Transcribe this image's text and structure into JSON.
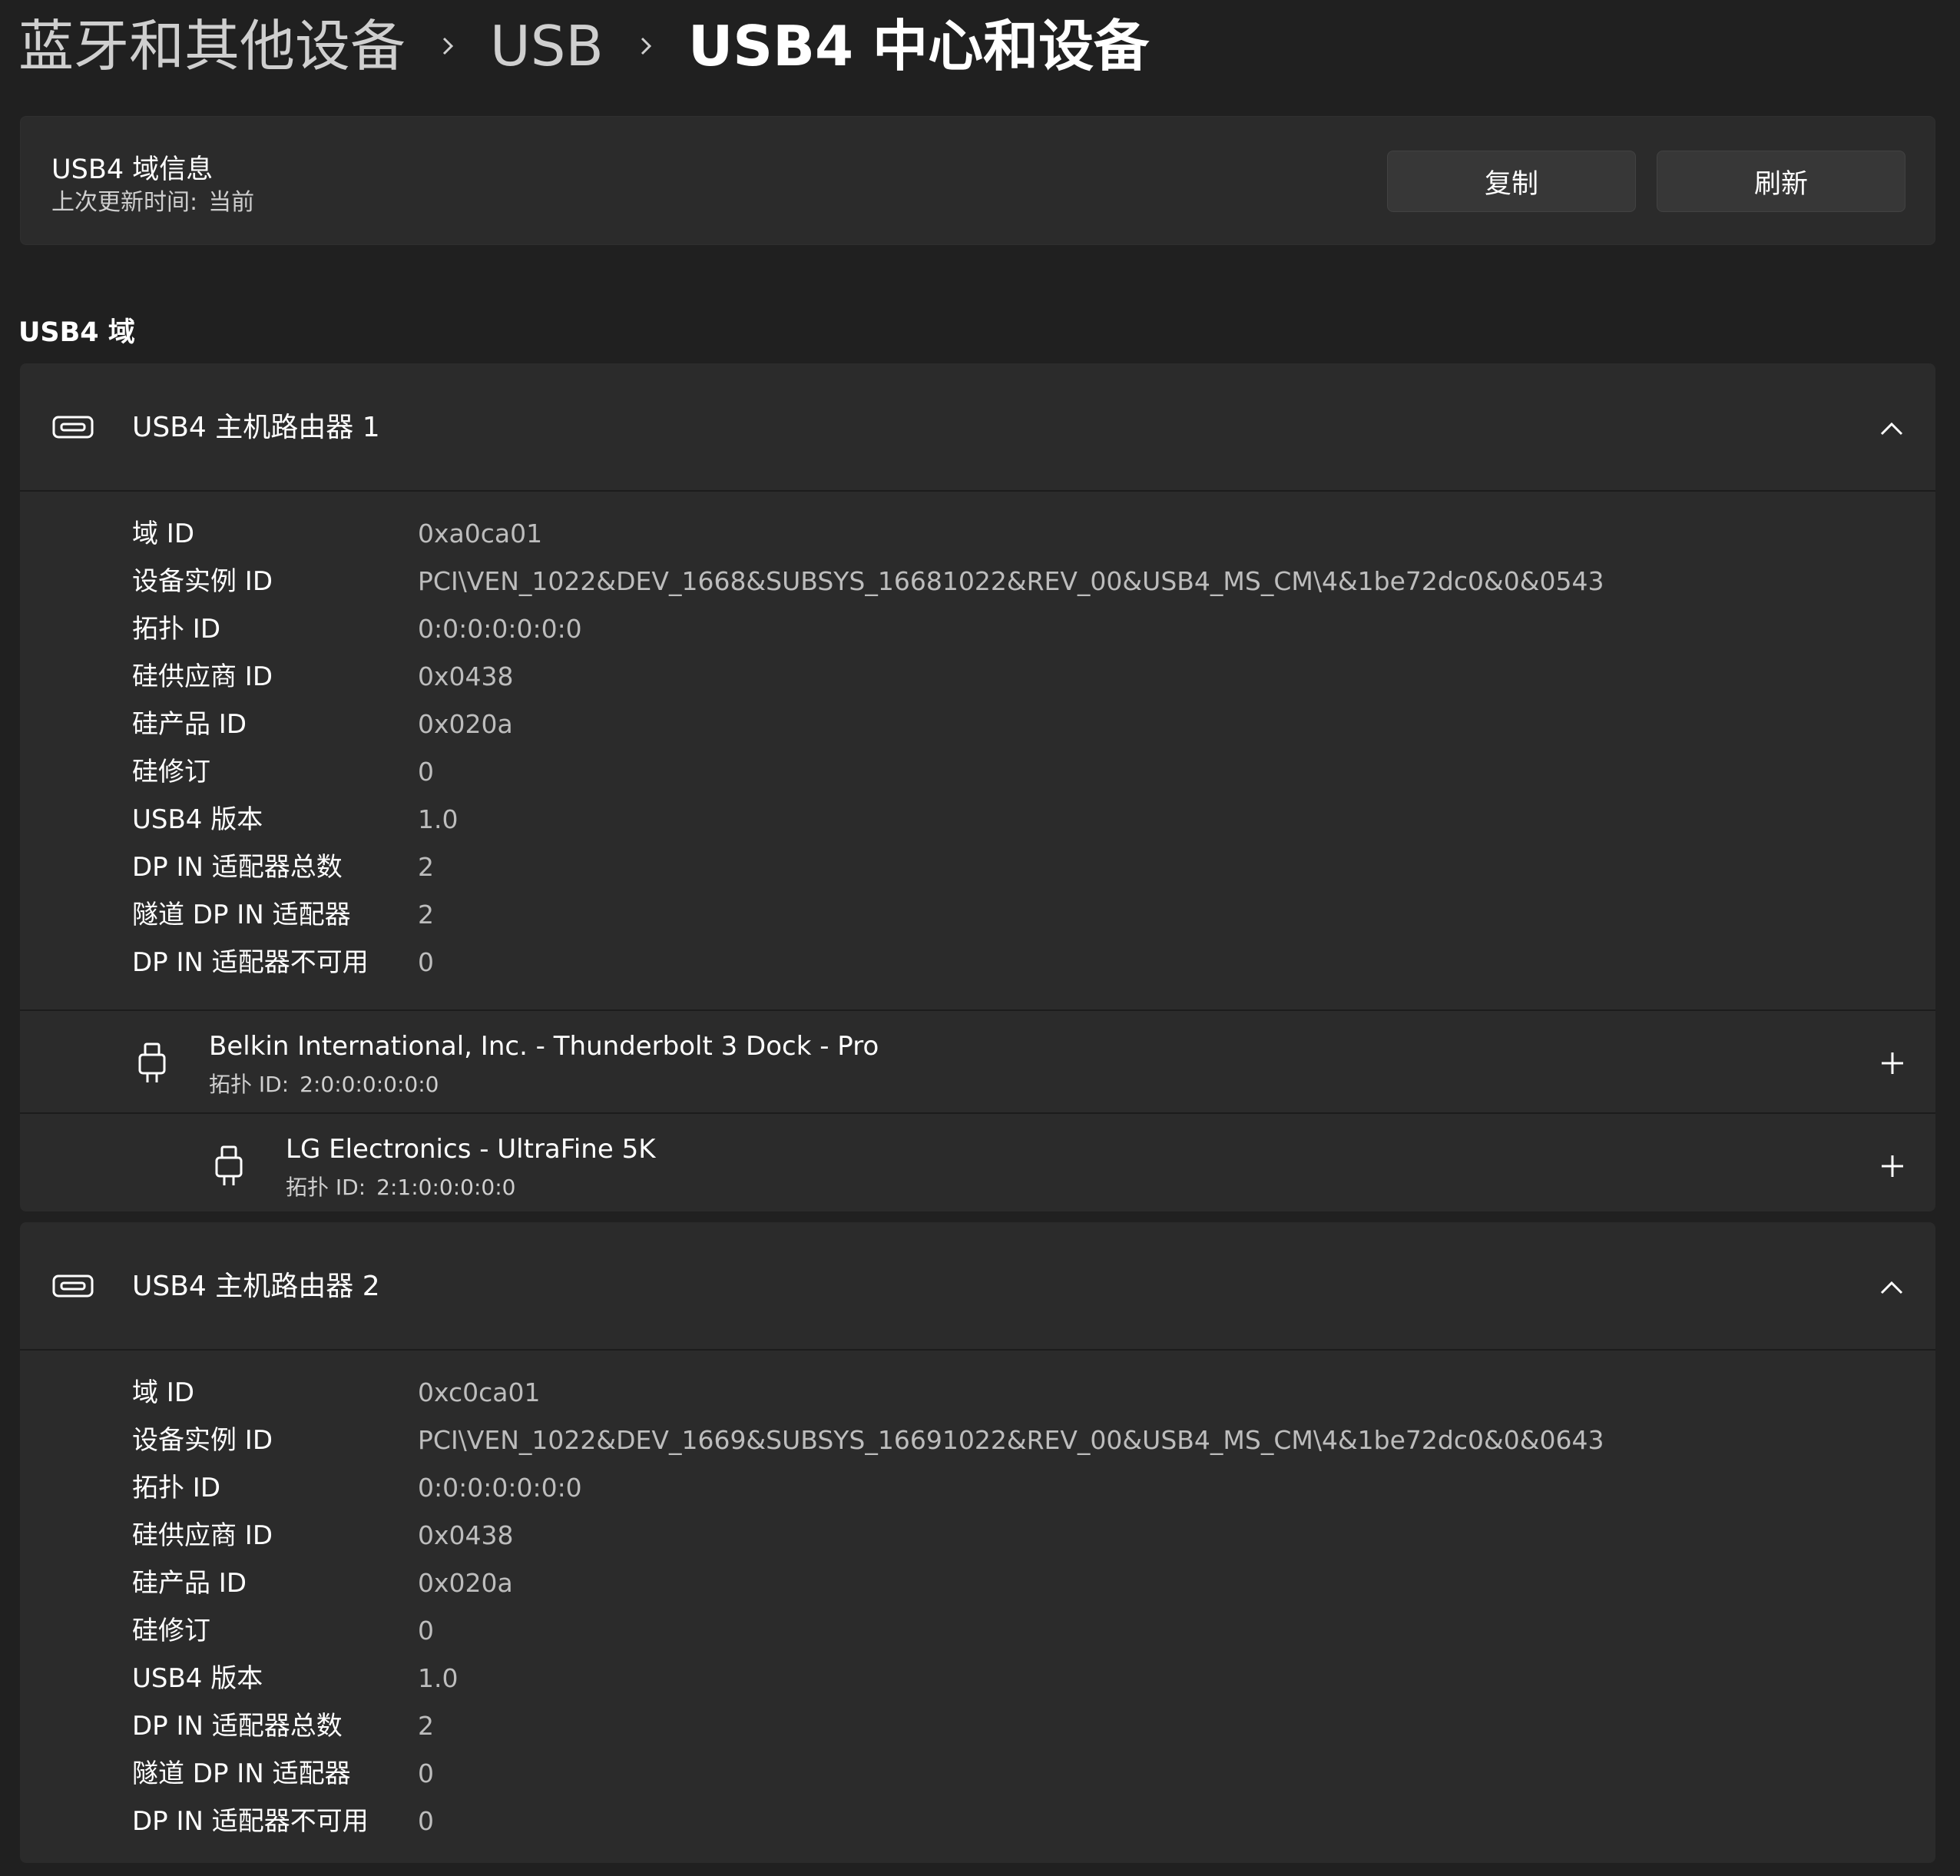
{
  "breadcrumb": {
    "items": [
      "蓝牙和其他设备",
      "USB",
      "USB4 中心和设备"
    ]
  },
  "info_card": {
    "title": "USB4 域信息",
    "updated_label": "上次更新时间:",
    "updated_value": "当前",
    "copy_label": "复制",
    "refresh_label": "刷新"
  },
  "section_heading": "USB4 域",
  "routers": [
    {
      "title": "USB4 主机路由器 1",
      "expanded": true,
      "properties": [
        {
          "label": "域 ID",
          "value": "0xa0ca01"
        },
        {
          "label": "设备实例 ID",
          "value": "PCI\\VEN_1022&DEV_1668&SUBSYS_16681022&REV_00&USB4_MS_CM\\4&1be72dc0&0&0543"
        },
        {
          "label": "拓扑 ID",
          "value": "0:0:0:0:0:0:0"
        },
        {
          "label": "硅供应商 ID",
          "value": "0x0438"
        },
        {
          "label": "硅产品 ID",
          "value": "0x020a"
        },
        {
          "label": "硅修订",
          "value": "0"
        },
        {
          "label": "USB4 版本",
          "value": "1.0"
        },
        {
          "label": "DP IN 适配器总数",
          "value": "2"
        },
        {
          "label": "隧道 DP IN 适配器",
          "value": "2"
        },
        {
          "label": "DP IN 适配器不可用",
          "value": "0"
        }
      ],
      "devices": [
        {
          "name": "Belkin International, Inc. - Thunderbolt 3 Dock - Pro",
          "topology_label": "拓扑 ID:",
          "topology_value": "2:0:0:0:0:0:0"
        },
        {
          "name": "LG Electronics - UltraFine 5K",
          "topology_label": "拓扑 ID:",
          "topology_value": "2:1:0:0:0:0:0"
        }
      ]
    },
    {
      "title": "USB4 主机路由器 2",
      "expanded": true,
      "properties": [
        {
          "label": "域 ID",
          "value": "0xc0ca01"
        },
        {
          "label": "设备实例 ID",
          "value": "PCI\\VEN_1022&DEV_1669&SUBSYS_16691022&REV_00&USB4_MS_CM\\4&1be72dc0&0&0643"
        },
        {
          "label": "拓扑 ID",
          "value": "0:0:0:0:0:0:0"
        },
        {
          "label": "硅供应商 ID",
          "value": "0x0438"
        },
        {
          "label": "硅产品 ID",
          "value": "0x020a"
        },
        {
          "label": "硅修订",
          "value": "0"
        },
        {
          "label": "USB4 版本",
          "value": "1.0"
        },
        {
          "label": "DP IN 适配器总数",
          "value": "2"
        },
        {
          "label": "隧道 DP IN 适配器",
          "value": "0"
        },
        {
          "label": "DP IN 适配器不可用",
          "value": "0"
        }
      ],
      "devices": []
    }
  ]
}
